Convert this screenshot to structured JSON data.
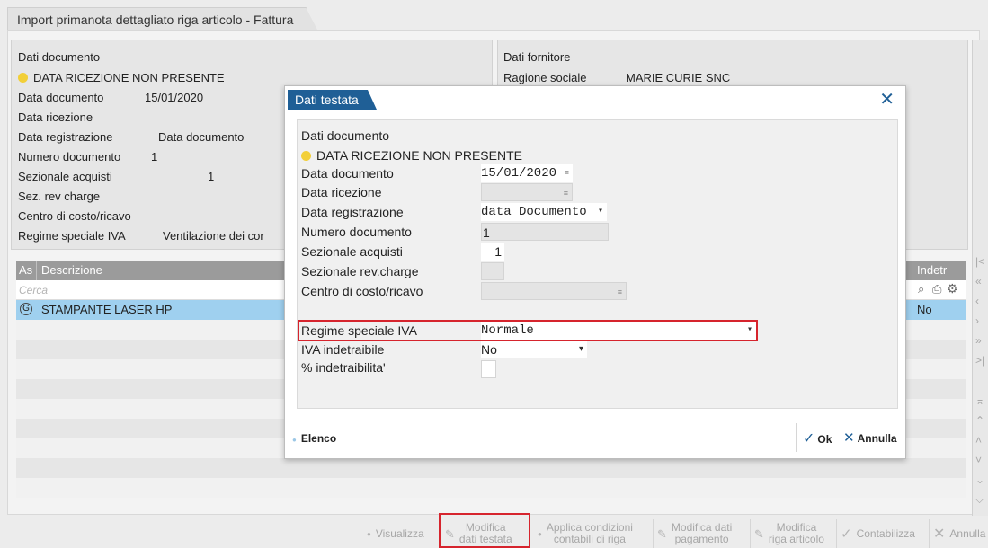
{
  "window": {
    "title": "Import primanota dettagliato riga articolo - Fattura"
  },
  "doc_panel": {
    "title": "Dati documento",
    "warning": "DATA RICEZIONE NON PRESENTE",
    "rows": [
      {
        "label": "Data documento",
        "value": "15/01/2020"
      },
      {
        "label": "Data ricezione",
        "value": ""
      },
      {
        "label": "Data registrazione",
        "value": "Data documento"
      },
      {
        "label": "Numero documento",
        "value": "1"
      },
      {
        "label": "Sezionale acquisti",
        "value": "1"
      },
      {
        "label": "Sez. rev charge",
        "value": ""
      },
      {
        "label": "Centro di costo/ricavo",
        "value": ""
      },
      {
        "label": "Regime speciale IVA",
        "value": "Ventilazione dei cor"
      }
    ]
  },
  "supplier_panel": {
    "title": "Dati fornitore",
    "rows": [
      {
        "label": "Ragione sociale",
        "value": "MARIE CURIE SNC"
      }
    ]
  },
  "grid": {
    "columns": {
      "as": "As",
      "descrizione": "Descrizione",
      "indetr": "Indetr"
    },
    "search_placeholder": "Cerca",
    "rows": [
      {
        "as": "G",
        "descrizione": "STAMPANTE LASER HP",
        "indetr": "No"
      }
    ]
  },
  "dialog": {
    "tab_title": "Dati testata",
    "section_title": "Dati documento",
    "warning": "DATA RICEZIONE NON PRESENTE",
    "fields": {
      "data_documento": {
        "label": "Data documento",
        "value": "15/01/2020"
      },
      "data_ricezione": {
        "label": "Data ricezione",
        "value": ""
      },
      "data_registrazione": {
        "label": "Data registrazione",
        "value": "data Documento"
      },
      "numero_documento": {
        "label": "Numero documento",
        "value": "1"
      },
      "sezionale_acquisti": {
        "label": "Sezionale acquisti",
        "value": "1"
      },
      "sezionale_rev_charge": {
        "label": "Sezionale rev.charge",
        "value": ""
      },
      "centro_costo": {
        "label": "Centro di costo/ricavo",
        "value": ""
      },
      "regime_speciale": {
        "label": "Regime speciale IVA",
        "value": "Normale"
      },
      "iva_indetraibile": {
        "label": "IVA indetraibile",
        "value": "No"
      },
      "perc_indetraibilita": {
        "label": "% indetraibilita'",
        "value": ""
      }
    },
    "buttons": {
      "elenco": "Elenco",
      "ok": "Ok",
      "annulla": "Annulla"
    }
  },
  "bottom_bar": {
    "visualizza": "Visualizza",
    "modifica_testata": [
      "Modifica",
      "dati testata"
    ],
    "applica_condizioni": [
      "Applica condizioni",
      "contabili di riga"
    ],
    "modifica_pagamento": [
      "Modifica dati",
      "pagamento"
    ],
    "modifica_articolo": [
      "Modifica",
      "riga articolo"
    ],
    "contabilizza": "Contabilizza",
    "annulla": "Annulla"
  },
  "colors": {
    "accent": "#1f5f96",
    "title_blue": "#1e7fb8",
    "highlight": "#d6242d",
    "warning_dot": "#f2cf38",
    "selected_row": "#9fd0ef"
  }
}
